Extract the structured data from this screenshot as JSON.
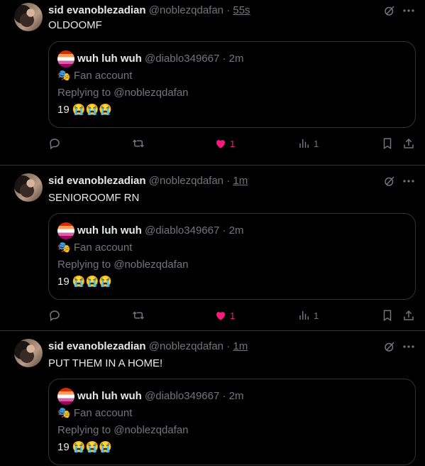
{
  "tweets": [
    {
      "author_name": "sid evanoblezadian",
      "author_handle": "@noblezqdafan",
      "separator": "·",
      "time": "55s",
      "text": "OLDOOMF",
      "quote": {
        "author_name": "wuh luh wuh",
        "author_handle": "@diablo349667",
        "separator": "·",
        "time": "2m",
        "badge_emoji": "🎭",
        "badge_text": "Fan account",
        "replying_to": "Replying to @noblezqdafan",
        "text": "19 😭😭😭"
      },
      "replies": "",
      "retweets": "",
      "likes": "1",
      "views": "1"
    },
    {
      "author_name": "sid evanoblezadian",
      "author_handle": "@noblezqdafan",
      "separator": "·",
      "time": "1m",
      "text": "SENIOROOMF RN",
      "quote": {
        "author_name": "wuh luh wuh",
        "author_handle": "@diablo349667",
        "separator": "·",
        "time": "2m",
        "badge_emoji": "🎭",
        "badge_text": "Fan account",
        "replying_to": "Replying to @noblezqdafan",
        "text": "19 😭😭😭"
      },
      "replies": "",
      "retweets": "",
      "likes": "1",
      "views": "1"
    },
    {
      "author_name": "sid evanoblezadian",
      "author_handle": "@noblezqdafan",
      "separator": "·",
      "time": "1m",
      "text": "PUT THEM IN A HOME!",
      "quote": {
        "author_name": "wuh luh wuh",
        "author_handle": "@diablo349667",
        "separator": "·",
        "time": "2m",
        "badge_emoji": "🎭",
        "badge_text": "Fan account",
        "replying_to": "Replying to @noblezqdafan",
        "text": "19 😭😭😭"
      },
      "replies": "",
      "retweets": "",
      "likes": "",
      "views": ""
    }
  ],
  "colors": {
    "background": "#000000",
    "text": "#e7e9ea",
    "muted": "#71767b",
    "border": "#2f3336",
    "like": "#f91880"
  },
  "icons": [
    "grok-icon",
    "more-icon",
    "reply-icon",
    "retweet-icon",
    "like-icon",
    "views-icon",
    "bookmark-icon",
    "share-icon"
  ]
}
